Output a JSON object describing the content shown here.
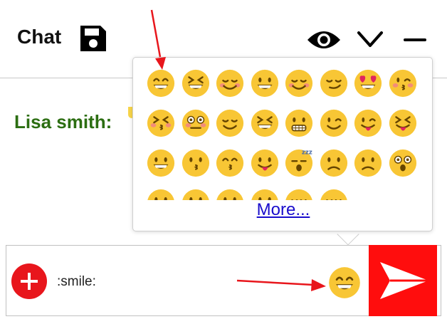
{
  "header": {
    "title": "Chat",
    "icons": [
      "save-icon",
      "eye-icon",
      "chevron-down-icon",
      "minimize-icon"
    ]
  },
  "message": {
    "sender": "Lisa smith:"
  },
  "emoji_picker": {
    "more_label": "More...",
    "emojis": [
      "smile",
      "laughing",
      "blush",
      "smiley",
      "relaxed",
      "smirk",
      "heart_eyes",
      "kissing_heart",
      "kissing_closed_eyes",
      "flushed",
      "relieved",
      "satisfied",
      "grimacing",
      "wink",
      "stuck_out_tongue_winking_eye",
      "stuck_out_tongue_closed_eyes",
      "grinning",
      "kissing",
      "kissing_smiling_eyes",
      "stuck_out_tongue",
      "sleeping",
      "worried",
      "frowning",
      "anguished",
      "open_mouth",
      "grimacing",
      "confused",
      "hushed",
      "expressionless",
      "unamused"
    ]
  },
  "composer": {
    "input_value": ":smile:",
    "preview_emoji": "smile"
  },
  "colors": {
    "accent_red": "#ff0d0d",
    "sender_green": "#2c6e12",
    "link_blue": "#1a0dcc",
    "emoji_yellow": "#f8c635"
  }
}
